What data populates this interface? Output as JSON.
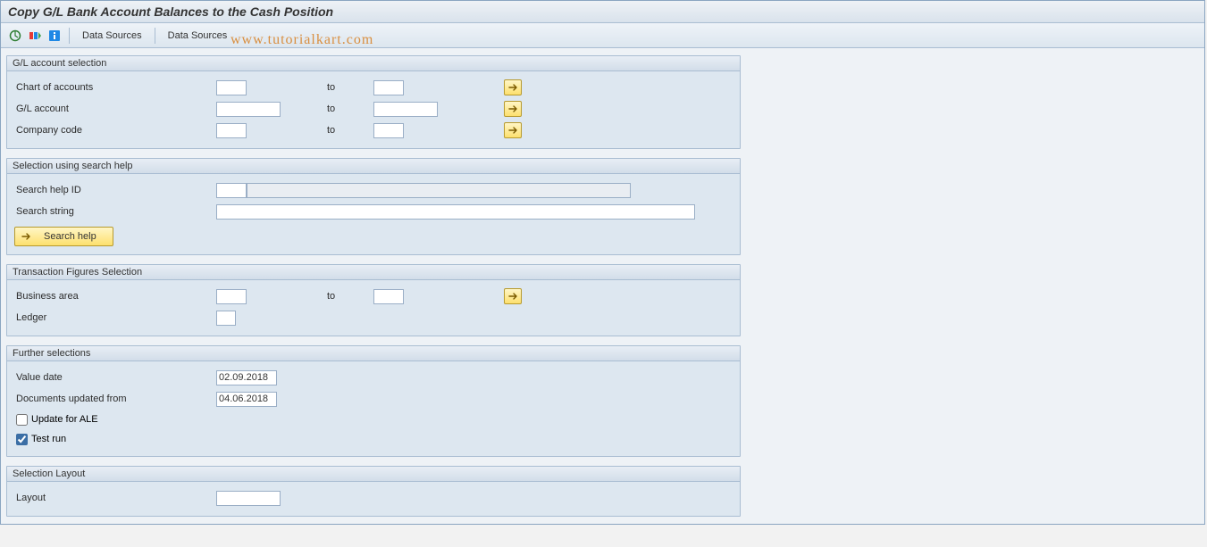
{
  "title": "Copy G/L Bank Account Balances to the Cash Position",
  "toolbar": {
    "data_sources_1": "Data Sources",
    "data_sources_2": "Data Sources"
  },
  "watermark": "www.tutorialkart.com",
  "groups": {
    "gl": {
      "title": "G/L account selection",
      "chart_label": "Chart of accounts",
      "gl_label": "G/L account",
      "cc_label": "Company code",
      "to": "to",
      "chart_from": "",
      "chart_to": "",
      "gl_from": "",
      "gl_to": "",
      "cc_from": "",
      "cc_to": ""
    },
    "sh": {
      "title": "Selection using search help",
      "id_label": "Search help ID",
      "str_label": "Search string",
      "id_value": "",
      "str_value": "",
      "btn": "Search help"
    },
    "tf": {
      "title": "Transaction Figures Selection",
      "ba_label": "Business area",
      "ledger_label": "Ledger",
      "to": "to",
      "ba_from": "",
      "ba_to": "",
      "ledger": ""
    },
    "fs": {
      "title": "Further selections",
      "vd_label": "Value date",
      "du_label": "Documents updated from",
      "ale_label": "Update for ALE",
      "test_label": "Test run",
      "vd_value": "02.09.2018",
      "du_value": "04.06.2018",
      "ale_checked": false,
      "test_checked": true
    },
    "sl": {
      "title": "Selection Layout",
      "layout_label": "Layout",
      "layout_value": ""
    }
  }
}
